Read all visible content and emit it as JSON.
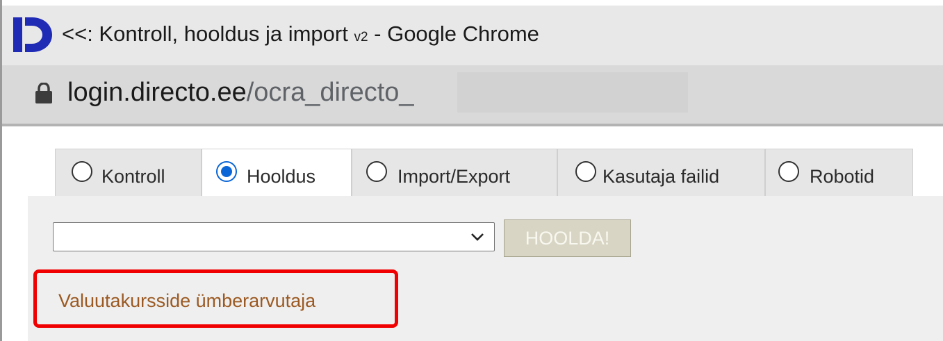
{
  "window": {
    "title_main": "<<: Kontroll, hooldus ja import ",
    "title_sub": "v2",
    "title_tail": " - Google Chrome",
    "logo_icon": "directo-logo-icon",
    "logo_color": "#1f2ab5"
  },
  "address": {
    "lock_icon": "lock-icon",
    "host": "login.directo.ee",
    "path": "/ocra_directo_"
  },
  "tabs": [
    {
      "label": "Kontroll",
      "selected": false
    },
    {
      "label": "Hooldus",
      "selected": true
    },
    {
      "label": "Import/Export",
      "selected": false
    },
    {
      "label": "Kasutaja failid",
      "selected": false
    },
    {
      "label": "Robotid",
      "selected": false
    }
  ],
  "maintenance": {
    "select_value": "",
    "select_icon": "chevron-down-icon",
    "button_label": "HOOLDA!",
    "link_label": "Valuutakursside ümberarvutaja",
    "highlight_color": "#f00000"
  }
}
